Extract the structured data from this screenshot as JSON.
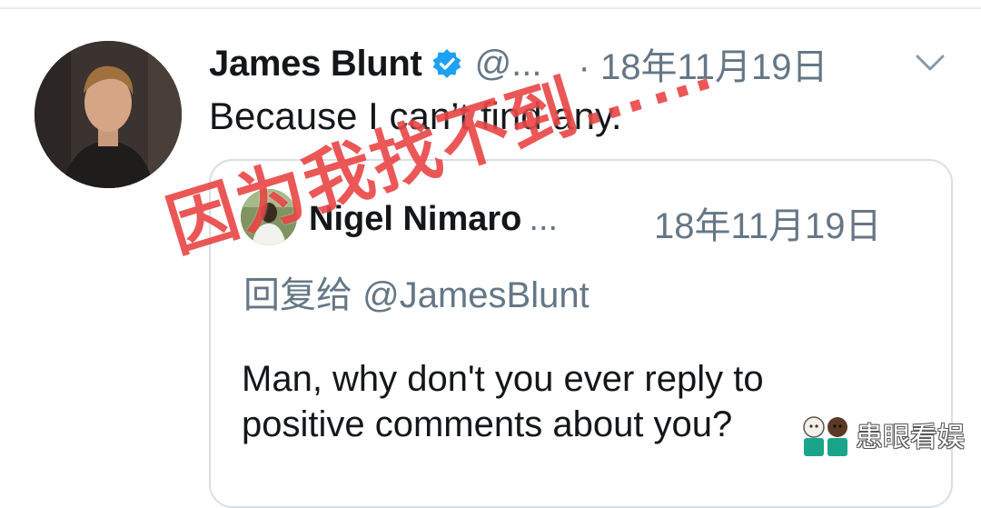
{
  "tweet": {
    "author_name": "James Blunt",
    "author_handle": "@...",
    "date": "· 18年11月19日",
    "text": "Because I can’t find any."
  },
  "quoted_tweet": {
    "author_name": "Nigel Nimaro",
    "author_handle": "...",
    "date": "18年11月19日",
    "reply_prefix": "回复给 ",
    "reply_handle": "@JamesBlunt",
    "body_line1": "Man, why don't you ever reply to",
    "body_line2": "positive comments about you?"
  },
  "overlay": {
    "caption": "因为我找不到……",
    "caption_color": "#e62828"
  },
  "watermark": {
    "text": "患眼看娱"
  },
  "colors": {
    "verified_blue": "#1da1f2",
    "muted_text": "#657786",
    "border": "#d8dfe5"
  },
  "icons": [
    "verified-badge-icon",
    "chevron-down-icon",
    "watermark-logo-icon"
  ]
}
